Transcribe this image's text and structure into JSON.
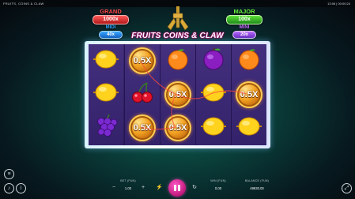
{
  "topbar": {
    "game_title": "FRUITS, COINS & CLAW",
    "clock": "13:06 | 00:00:24"
  },
  "jackpots": {
    "grand": {
      "label": "GRAND",
      "value": "1000x"
    },
    "midi": {
      "label": "MIDI",
      "value": "40x"
    },
    "major": {
      "label": "MAJOR",
      "value": "100x"
    },
    "mini": {
      "label": "MINI",
      "value": "20x"
    }
  },
  "logo": {
    "text": "FRUITS COINS & CLAW"
  },
  "reels": [
    [
      {
        "symbol": "lemon"
      },
      {
        "symbol": "lemon"
      },
      {
        "symbol": "grapes"
      }
    ],
    [
      {
        "symbol": "coin",
        "label": "0.5X"
      },
      {
        "symbol": "cherry"
      },
      {
        "symbol": "coin",
        "label": "0.5X"
      }
    ],
    [
      {
        "symbol": "orange"
      },
      {
        "symbol": "coin",
        "label": "0.5X"
      },
      {
        "symbol": "coin",
        "label": "0.5X"
      }
    ],
    [
      {
        "symbol": "plum"
      },
      {
        "symbol": "lemon"
      },
      {
        "symbol": "lemon"
      }
    ],
    [
      {
        "symbol": "orange"
      },
      {
        "symbol": "coin",
        "label": "0.5X"
      },
      {
        "symbol": "lemon"
      }
    ]
  ],
  "controls": {
    "bet_label": "BET (FUN)",
    "bet_value": "1.00",
    "win_label": "WIN (FUN)",
    "win_value": "0.00",
    "balance_label": "BALANCE (FUN)",
    "balance_value": "49930.00"
  },
  "icons": {
    "menu": "menu-icon",
    "sound": "speaker-icon",
    "info": "info-icon",
    "settings": "gear-icon",
    "bet_minus": "minus-icon",
    "bet_plus": "plus-icon",
    "autoplay": "autoplay-icon",
    "turbo": "lightning-icon",
    "fullscreen": "fullscreen-icon"
  },
  "colors": {
    "grand": "#ff4a4a",
    "major": "#6cf03e",
    "midi": "#2ea8ff",
    "mini": "#c66cff",
    "spin": "#e0289a"
  }
}
